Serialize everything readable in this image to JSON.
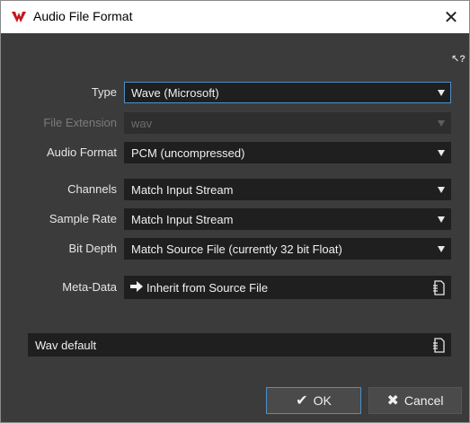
{
  "window": {
    "title": "Audio File Format",
    "close_glyph": "✕"
  },
  "help": {
    "glyph": "↖?"
  },
  "form": {
    "type": {
      "label": "Type",
      "value": "Wave (Microsoft)"
    },
    "file_extension": {
      "label": "File Extension",
      "value": "wav"
    },
    "audio_format": {
      "label": "Audio Format",
      "value": "PCM (uncompressed)"
    },
    "channels": {
      "label": "Channels",
      "value": "Match Input Stream"
    },
    "sample_rate": {
      "label": "Sample Rate",
      "value": "Match Input Stream"
    },
    "bit_depth": {
      "label": "Bit Depth",
      "value": "Match Source File (currently 32 bit Float)"
    },
    "meta_data": {
      "label": "Meta-Data",
      "value": "Inherit from Source File"
    }
  },
  "preset": {
    "value": "Wav default"
  },
  "buttons": {
    "ok": {
      "label": "OK",
      "icon_glyph": "✔"
    },
    "cancel": {
      "label": "Cancel",
      "icon_glyph": "✖"
    }
  },
  "colors": {
    "panel_bg": "#3b3b3b",
    "field_bg": "#1f1f1f",
    "focus_accent": "#4f8fc8",
    "logo_red": "#c4161c"
  }
}
